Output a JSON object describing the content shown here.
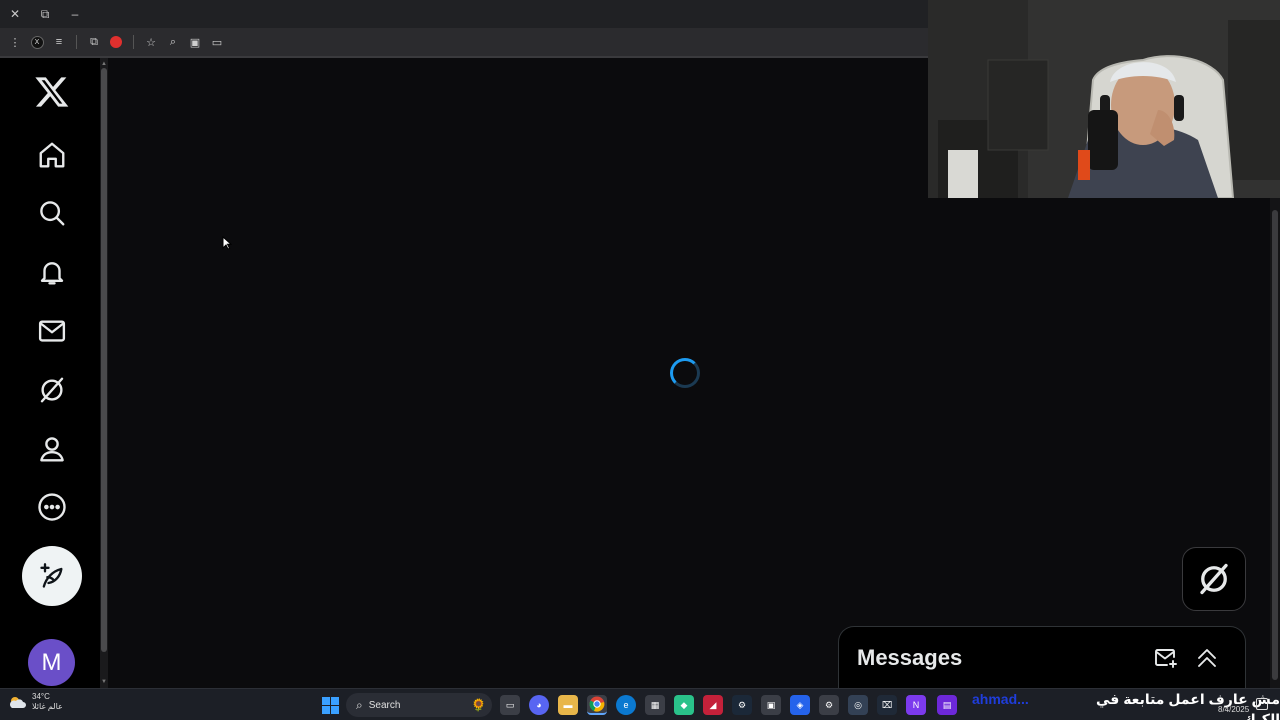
{
  "browser": {
    "controls": {
      "close": "✕",
      "restore": "⧉",
      "minimize": "–"
    }
  },
  "sidebar": {
    "items": [
      {
        "icon": "x-logo"
      },
      {
        "icon": "home-icon"
      },
      {
        "icon": "search-icon"
      },
      {
        "icon": "bell-icon"
      },
      {
        "icon": "mail-icon"
      },
      {
        "icon": "grok-icon"
      },
      {
        "icon": "profile-icon"
      },
      {
        "icon": "more-icon"
      }
    ],
    "compose_icon": "feather-plus-icon",
    "avatar_letter": "M"
  },
  "main": {
    "state": "loading"
  },
  "messages": {
    "title": "Messages"
  },
  "taskbar": {
    "weather_temp": "34°C",
    "weather_desc": "عالم غائلا",
    "search_label": "Search",
    "stream_user": "ahmad...",
    "stream_message": "مش عارف اعمل متابعة في الكيك",
    "date": "8/4/2025"
  },
  "colors": {
    "accent": "#1d9bf0",
    "avatar": "#6a4fc8",
    "background": "#0b0b0d"
  }
}
